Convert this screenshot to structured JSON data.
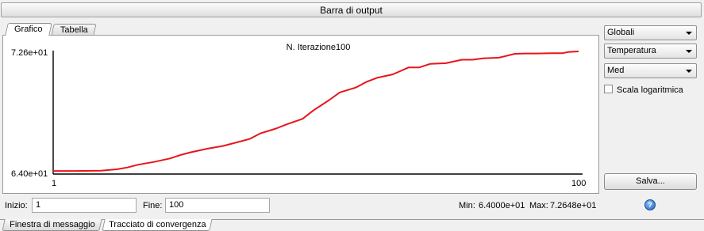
{
  "window": {
    "title": "Barra di output"
  },
  "tabs": [
    {
      "label": "Grafico",
      "active": true
    },
    {
      "label": "Tabella",
      "active": false
    }
  ],
  "chart_data": {
    "type": "line",
    "title": "N. Iterazione100",
    "xlabel": "",
    "ylabel": "",
    "xlim": [
      1,
      100
    ],
    "ylim": [
      64.0,
      72.648
    ],
    "x_tick_labels": [
      "1",
      "100"
    ],
    "y_tick_labels": [
      "6.40e+01",
      "7.26e+01"
    ],
    "grid": false,
    "line_color": "#e8141a",
    "series": [
      {
        "x": [
          1,
          5,
          10,
          13,
          15,
          17,
          20,
          23,
          25,
          27,
          30,
          33,
          35,
          38,
          40,
          43,
          45,
          48,
          50,
          53,
          55,
          58,
          60,
          62,
          65,
          68,
          70,
          72,
          75,
          78,
          80,
          82,
          85,
          88,
          90,
          92,
          95,
          97,
          98,
          100
        ],
        "y": [
          64.05,
          64.05,
          64.07,
          64.17,
          64.3,
          64.5,
          64.7,
          64.95,
          65.2,
          65.4,
          65.65,
          65.85,
          66.05,
          66.35,
          66.75,
          67.1,
          67.4,
          67.8,
          68.4,
          69.15,
          69.7,
          70.05,
          70.45,
          70.75,
          71.0,
          71.5,
          71.5,
          71.75,
          71.8,
          72.05,
          72.05,
          72.15,
          72.2,
          72.48,
          72.5,
          72.5,
          72.52,
          72.52,
          72.6,
          72.65
        ]
      }
    ]
  },
  "sidebar": {
    "combos": [
      "Globali",
      "Temperatura",
      "Med"
    ],
    "log_scale": {
      "label": "Scala logaritmica",
      "checked": false
    },
    "save_label": "Salva..."
  },
  "range": {
    "start_label": "Inizio:",
    "start_value": "1",
    "end_label": "Fine:",
    "end_value": "100"
  },
  "stats": {
    "min_label": "Min:",
    "min_value": "6.4000e+01",
    "max_label": "Max:",
    "max_value": "7.2648e+01"
  },
  "bottom_tabs": [
    {
      "label": "Finestra di messaggio",
      "active": false
    },
    {
      "label": "Tracciato di convergenza",
      "active": true
    }
  ]
}
